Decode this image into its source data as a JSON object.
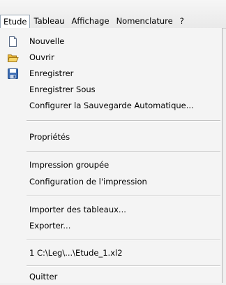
{
  "menubar": {
    "items": [
      "Etude",
      "Tableau",
      "Affichage",
      "Nomenclature",
      "?"
    ]
  },
  "menu": {
    "items": [
      {
        "label": "Nouvelle",
        "icon": "new-file-icon"
      },
      {
        "label": "Ouvrir",
        "icon": "folder-open-icon"
      },
      {
        "label": "Enregistrer",
        "icon": "floppy-save-icon"
      },
      {
        "label": "Enregistrer Sous"
      },
      {
        "label": "Configurer la Sauvegarde Automatique..."
      },
      {
        "label": "Propriétés"
      },
      {
        "label": "Impression groupée"
      },
      {
        "label": "Configuration de l'impression"
      },
      {
        "label": "Importer des tableaux..."
      },
      {
        "label": "Exporter..."
      },
      {
        "label": "1 C:\\Leg\\...\\Etude_1.xl2"
      },
      {
        "label": "Quitter"
      }
    ]
  }
}
